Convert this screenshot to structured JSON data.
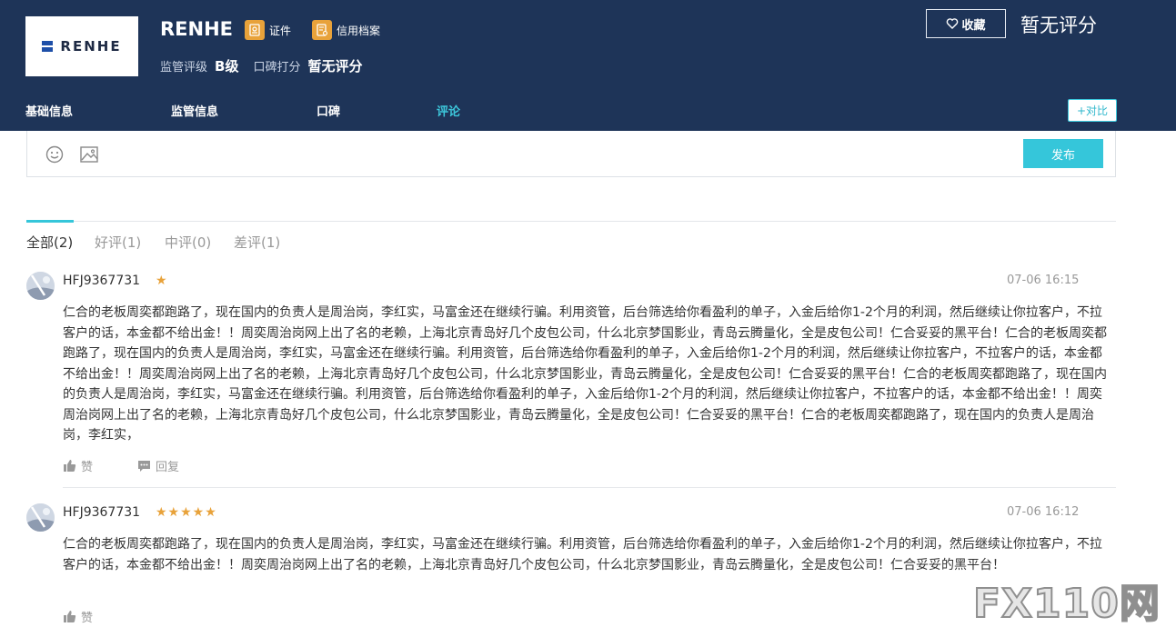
{
  "broker": {
    "logo_text": "RENHE",
    "name": "RENHE",
    "badges": [
      {
        "label": "证件",
        "icon": "certificate-icon"
      },
      {
        "label": "信用档案",
        "icon": "credit-file-icon"
      }
    ],
    "regulation_label": "监管评级",
    "regulation_value": "B级",
    "reputation_label": "口碑打分",
    "reputation_value": "暂无评分",
    "favorite_label": "收藏",
    "top_score": "暂无评分"
  },
  "nav": {
    "items": [
      "基础信息",
      "监管信息",
      "口碑",
      "评论"
    ],
    "active_index": 3,
    "compare_label": "+对比"
  },
  "editor": {
    "publish_label": "发布",
    "icons": [
      "emoji-icon",
      "image-icon"
    ]
  },
  "filter_tabs": [
    {
      "label": "全部(2)",
      "active": true
    },
    {
      "label": "好评(1)",
      "active": false
    },
    {
      "label": "中评(0)",
      "active": false
    },
    {
      "label": "差评(1)",
      "active": false
    }
  ],
  "reviews": [
    {
      "user": "HFJ9367731",
      "stars": 1,
      "star_text": "★",
      "time": "07-06 16:15",
      "text": "仁合的老板周奕都跑路了，现在国内的负责人是周治岗，李红实，马富金还在继续行骗。利用资管，后台筛选给你看盈利的单子，入金后给你1-2个月的利润，然后继续让你拉客户，不拉客户的话，本金都不给出金！！周奕周治岗网上出了名的老赖，上海北京青岛好几个皮包公司，什么北京梦国影业，青岛云腾量化，全是皮包公司！仁合妥妥的黑平台！仁合的老板周奕都跑路了，现在国内的负责人是周治岗，李红实，马富金还在继续行骗。利用资管，后台筛选给你看盈利的单子，入金后给你1-2个月的利润，然后继续让你拉客户，不拉客户的话，本金都不给出金！！周奕周治岗网上出了名的老赖，上海北京青岛好几个皮包公司，什么北京梦国影业，青岛云腾量化，全是皮包公司！仁合妥妥的黑平台！仁合的老板周奕都跑路了，现在国内的负责人是周治岗，李红实，马富金还在继续行骗。利用资管，后台筛选给你看盈利的单子，入金后给你1-2个月的利润，然后继续让你拉客户，不拉客户的话，本金都不给出金！！周奕周治岗网上出了名的老赖，上海北京青岛好几个皮包公司，什么北京梦国影业，青岛云腾量化，全是皮包公司！仁合妥妥的黑平台！仁合的老板周奕都跑路了，现在国内的负责人是周治岗，李红实，",
      "like_label": "赞",
      "reply_label": "回复"
    },
    {
      "user": "HFJ9367731",
      "stars": 5,
      "star_text": "★★★★★",
      "time": "07-06 16:12",
      "text": "仁合的老板周奕都跑路了，现在国内的负责人是周治岗，李红实，马富金还在继续行骗。利用资管，后台筛选给你看盈利的单子，入金后给你1-2个月的利润，然后继续让你拉客户，不拉客户的话，本金都不给出金！！周奕周治岗网上出了名的老赖，上海北京青岛好几个皮包公司，什么北京梦国影业，青岛云腾量化，全是皮包公司！仁合妥妥的黑平台！",
      "like_label": "赞"
    }
  ],
  "watermark": "FX110网"
}
